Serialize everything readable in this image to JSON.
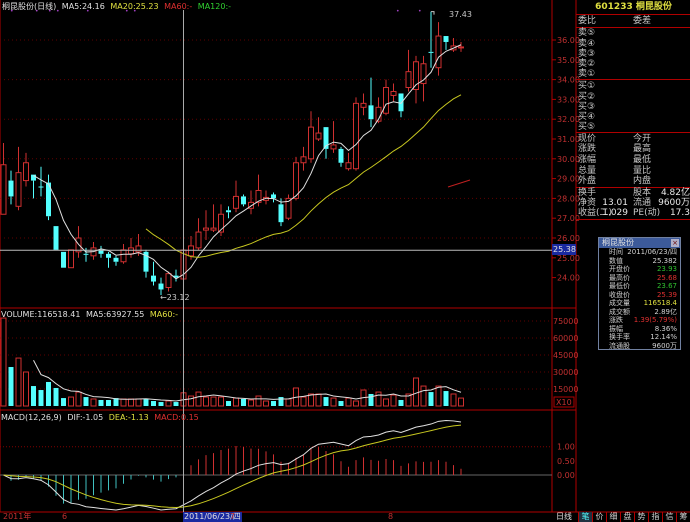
{
  "header": {
    "stock_name": "桐昆股份(日线)",
    "ma5": "MA5:24.16",
    "ma20": "MA20:25.23",
    "ma60": "MA60:-",
    "ma120": "MA120:-"
  },
  "volume_header": {
    "volume": "VOLUME:116518.41",
    "ma5": "MA5:63927.55",
    "ma60": "MA60:-"
  },
  "macd_header": {
    "name": "MACD(12,26,9)",
    "dif": "DIF:-1.05",
    "dea": "DEA:-1.13",
    "macd": "MACD:0.15"
  },
  "annotations": {
    "high": "37.43",
    "low": "←23.12"
  },
  "price_axis": [
    "36.00",
    "35.00",
    "34.00",
    "33.00",
    "32.00",
    "31.00",
    "30.00",
    "29.00",
    "28.00",
    "27.00",
    "26.00",
    "25.00",
    "24.00"
  ],
  "crosshair_price": "25.38",
  "volume_axis": [
    "75000",
    "60000",
    "45000",
    "30000",
    "15000"
  ],
  "volume_multiplier": "X10",
  "macd_axis": [
    "1.00",
    "0.50",
    "0.00"
  ],
  "date_axis": {
    "year": "2011年",
    "m6": "6",
    "cursor_date": "2011/06/23/四",
    "m7": "7",
    "m8": "8"
  },
  "quote": {
    "title": "601233 桐昆股份",
    "order_header": [
      "委比",
      "委差"
    ],
    "sell": [
      "卖⑤",
      "卖④",
      "卖③",
      "卖②",
      "卖①"
    ],
    "buy": [
      "买①",
      "买②",
      "买③",
      "买④",
      "买⑤"
    ],
    "stats": [
      [
        "现价",
        "今开"
      ],
      [
        "涨跌",
        "最高"
      ],
      [
        "涨幅",
        "最低"
      ],
      [
        "总量",
        "量比"
      ],
      [
        "外盘",
        "内盘"
      ]
    ],
    "fundamentals": [
      {
        "l1": "换手",
        "v1": "",
        "l2": "股本",
        "v2": "4.82亿"
      },
      {
        "l1": "净资",
        "v1": "13.01",
        "l2": "流通",
        "v2": "9600万"
      },
      {
        "l1": "收益(二)",
        "v1": "1.029",
        "l2": "PE(动)",
        "v2": "17.3"
      }
    ]
  },
  "popup": {
    "title": "桐昆股份",
    "close": "×",
    "rows": [
      {
        "label": "时间",
        "value": "2011/06/23/四",
        "color": "#d0d0d0"
      },
      {
        "label": "数值",
        "value": "25.382",
        "color": "#d0d0d0"
      },
      {
        "label": "开盘价",
        "value": "23.93",
        "color": "#30c030"
      },
      {
        "label": "最高价",
        "value": "25.68",
        "color": "#e03030"
      },
      {
        "label": "最低价",
        "value": "23.67",
        "color": "#30c030"
      },
      {
        "label": "收盘价",
        "value": "25.39",
        "color": "#e03030"
      },
      {
        "label": "成交量",
        "value": "116518.4",
        "color": "#e0e040"
      },
      {
        "label": "成交额",
        "value": "2.89亿",
        "color": "#d0d0d0"
      },
      {
        "label": "涨跌",
        "value": "1.39(5.79%)",
        "color": "#e03030"
      },
      {
        "label": "振幅",
        "value": "8.36%",
        "color": "#d0d0d0"
      },
      {
        "label": "换手率",
        "value": "12.14%",
        "color": "#d0d0d0"
      },
      {
        "label": "流通股",
        "value": "9600万",
        "color": "#d0d0d0"
      }
    ]
  },
  "bottom_tabs": {
    "period": "日线",
    "tabs": [
      "笔",
      "价",
      "细",
      "盘",
      "势",
      "指",
      "信",
      "筹"
    ],
    "active": 0
  },
  "colors": {
    "up": "#d03030",
    "down": "#54ffff",
    "ma5": "#e0e0e0",
    "ma20": "#c8c820",
    "axis": "#b00000"
  },
  "chart_data": {
    "type": "candlestick",
    "cursor_index": 24,
    "ohlc": [
      [
        27.2,
        30.8,
        27.2,
        29.7
      ],
      [
        28.9,
        29.4,
        27.7,
        28.1
      ],
      [
        27.6,
        30.6,
        27.4,
        29.3
      ],
      [
        28.9,
        30.3,
        28.6,
        29.8
      ],
      [
        29.2,
        29.2,
        28.0,
        28.9
      ],
      [
        28.6,
        29.6,
        28.1,
        28.55
      ],
      [
        28.8,
        29.2,
        26.9,
        27.1
      ],
      [
        26.6,
        26.6,
        25.4,
        25.4
      ],
      [
        25.3,
        25.3,
        24.5,
        24.5
      ],
      [
        24.5,
        25.4,
        24.5,
        25.4
      ],
      [
        25.3,
        26.6,
        25.0,
        26.0
      ],
      [
        25.2,
        25.5,
        24.8,
        25.15
      ],
      [
        25.1,
        25.8,
        24.9,
        25.5
      ],
      [
        25.4,
        25.6,
        25.0,
        25.2
      ],
      [
        25.2,
        25.3,
        24.5,
        25.0
      ],
      [
        25.0,
        25.1,
        24.6,
        24.8
      ],
      [
        24.8,
        25.7,
        24.7,
        25.4
      ],
      [
        25.2,
        26.0,
        25.0,
        25.5
      ],
      [
        25.3,
        26.2,
        25.1,
        25.6
      ],
      [
        25.3,
        25.4,
        24.0,
        24.3
      ],
      [
        24.1,
        24.8,
        23.6,
        23.8
      ],
      [
        23.7,
        24.0,
        23.12,
        23.4
      ],
      [
        23.5,
        24.3,
        23.3,
        24.2
      ],
      [
        24.1,
        24.4,
        23.8,
        24.0
      ],
      [
        23.93,
        25.68,
        23.67,
        25.39
      ],
      [
        25.1,
        26.1,
        24.9,
        25.6
      ],
      [
        25.5,
        27.0,
        25.4,
        26.3
      ],
      [
        26.4,
        27.4,
        25.9,
        26.5
      ],
      [
        26.4,
        27.7,
        26.3,
        26.5
      ],
      [
        26.3,
        27.7,
        26.1,
        27.2
      ],
      [
        27.4,
        27.6,
        27.0,
        27.3
      ],
      [
        27.5,
        28.9,
        27.3,
        28.1
      ],
      [
        28.1,
        28.2,
        27.6,
        27.7
      ],
      [
        27.5,
        28.4,
        27.2,
        27.8
      ],
      [
        27.8,
        29.2,
        27.6,
        28.4
      ],
      [
        27.9,
        28.4,
        27.7,
        28.05
      ],
      [
        28.2,
        28.3,
        27.8,
        28.0
      ],
      [
        27.7,
        28.0,
        26.6,
        26.8
      ],
      [
        27.0,
        28.2,
        26.9,
        28.0
      ],
      [
        28.0,
        30.1,
        27.9,
        29.8
      ],
      [
        29.8,
        30.6,
        29.4,
        30.1
      ],
      [
        30.0,
        32.4,
        29.8,
        31.6
      ],
      [
        31.0,
        32.1,
        30.9,
        31.3
      ],
      [
        31.6,
        31.6,
        30.0,
        30.5
      ],
      [
        30.5,
        31.9,
        30.3,
        30.7
      ],
      [
        30.5,
        30.6,
        29.6,
        29.8
      ],
      [
        29.5,
        30.3,
        29.4,
        29.8
      ],
      [
        29.5,
        33.1,
        29.4,
        32.8
      ],
      [
        32.6,
        33.3,
        32.2,
        32.8
      ],
      [
        32.7,
        34.1,
        31.6,
        32.0
      ],
      [
        31.9,
        33.1,
        31.8,
        32.6
      ],
      [
        32.3,
        34.0,
        32.2,
        33.6
      ],
      [
        33.2,
        33.8,
        32.9,
        33.4
      ],
      [
        33.3,
        33.3,
        32.1,
        32.4
      ],
      [
        33.6,
        35.5,
        33.4,
        34.4
      ],
      [
        33.5,
        35.2,
        32.8,
        34.9
      ],
      [
        33.8,
        35.2,
        32.9,
        34.8
      ],
      [
        35.4,
        37.43,
        34.6,
        35.35
      ],
      [
        34.6,
        36.9,
        34.2,
        36.2
      ],
      [
        36.2,
        36.2,
        35.5,
        35.9
      ],
      [
        35.5,
        36.1,
        35.4,
        35.7
      ],
      [
        35.6,
        35.9,
        35.4,
        35.65
      ]
    ],
    "volume": [
      77600,
      34400,
      42300,
      30000,
      17600,
      14100,
      21200,
      15900,
      7000,
      7900,
      12300,
      7900,
      6200,
      5300,
      5300,
      7000,
      6200,
      6200,
      6200,
      6200,
      4400,
      3500,
      4400,
      3500,
      11652,
      8800,
      12300,
      7900,
      7900,
      7900,
      4400,
      7000,
      6200,
      5300,
      8800,
      4400,
      4400,
      7900,
      6200,
      15900,
      7900,
      10600,
      10600,
      7900,
      7000,
      4400,
      7000,
      4400,
      14100,
      10600,
      12300,
      6200,
      9700,
      5300,
      10600,
      24700,
      17600,
      12300,
      17600,
      13200,
      10600,
      7000
    ],
    "price_ylim": [
      23,
      37.5
    ],
    "volume_ylim": [
      0,
      80000
    ],
    "indicators": [
      "MA5",
      "MA20",
      "VOLUME MA5",
      "MACD(12,26,9)"
    ]
  }
}
